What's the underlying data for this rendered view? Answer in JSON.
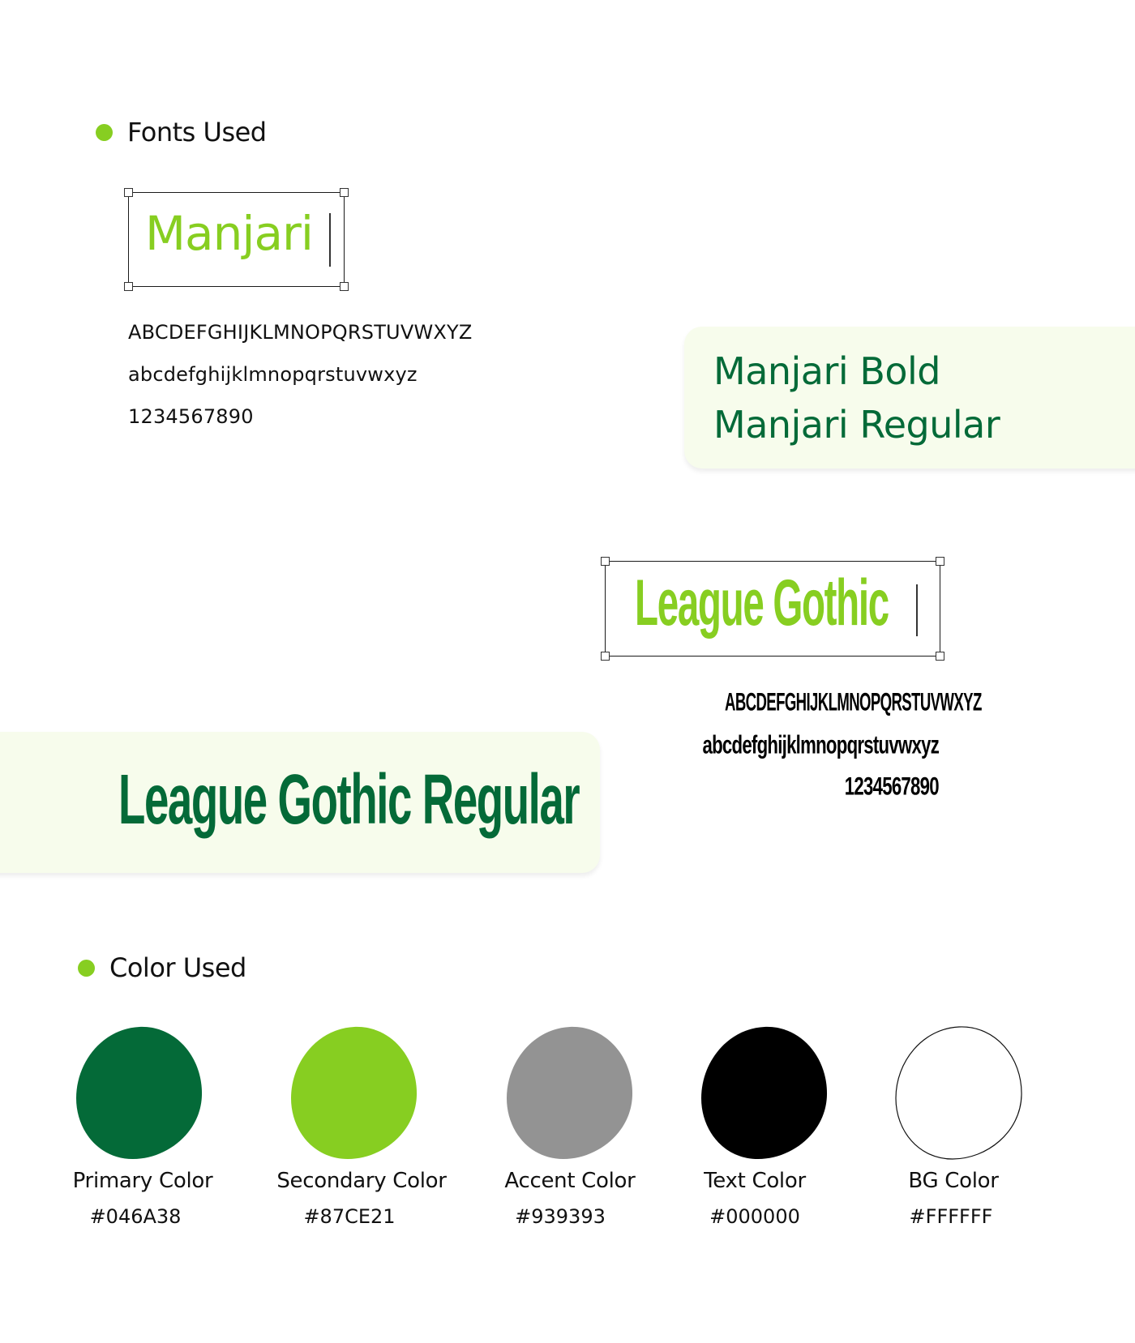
{
  "fonts_section": {
    "title": "Fonts Used"
  },
  "manjari": {
    "sample": "Manjari",
    "uppercase": "ABCDEFGHIJKLMNOPQRSTUVWXYZ",
    "lowercase": "abcdefghijklmnopqrstuvwxyz",
    "digits": "1234567890",
    "card_bold": "Manjari Bold",
    "card_regular": "Manjari Regular"
  },
  "league": {
    "sample": "League Gothic",
    "uppercase": "ABCDEFGHIJKLMNOPQRSTUVWXYZ",
    "lowercase": "abcdefghijklmnopqrstuvwxyz",
    "digits": "1234567890",
    "card_text": "League Gothic Regular"
  },
  "colors_section": {
    "title": "Color Used"
  },
  "palette": [
    {
      "label": "Primary Color",
      "hex": "#046A38",
      "fill": "#046A38"
    },
    {
      "label": "Secondary Color",
      "hex": "#87CE21",
      "fill": "#87CE21"
    },
    {
      "label": "Accent Color",
      "hex": "#939393",
      "fill": "#939393"
    },
    {
      "label": "Text Color",
      "hex": "#000000",
      "fill": "#000000"
    },
    {
      "label": "BG Color",
      "hex": "#FFFFFF",
      "fill": "#FFFFFF"
    }
  ],
  "accent_colors": {
    "primary": "#046A38",
    "secondary": "#87CE21",
    "card_bg": "#F7FCEC"
  }
}
